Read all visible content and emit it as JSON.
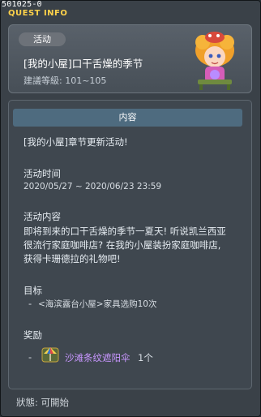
{
  "window": {
    "id_text": "501025-0",
    "title": "QUEST INFO"
  },
  "header": {
    "category": "活动",
    "quest_name": "[我的小屋]口干舌燥的季节",
    "level": "建議等級: 101~105"
  },
  "content": {
    "header": "内容",
    "intro": "[我的小屋]章节更新活动!",
    "period_label": "活动时间",
    "period_value": "2020/05/27 ~ 2020/06/23 23:59",
    "desc_label": "活动内容",
    "desc_lines": [
      "即将到来的口干舌燥的季节一夏天! 听说凯兰西亚",
      "很流行家庭咖啡店? 在我的小屋装扮家庭咖啡店,",
      "获得卡珊德拉的礼物吧!"
    ],
    "goal_label": "目标",
    "goal_dash": "-",
    "goal_item": "<海滨露台小屋>家具选购10次",
    "reward_label": "奖励",
    "reward_dash": "-",
    "reward_name": "沙滩条纹遮阳伞",
    "reward_count": "1个",
    "reward_icon": "beach-parasol-icon"
  },
  "status": "狀態: 可開始",
  "colors": {
    "title": "#ffd24a",
    "reward_name": "#c896ff",
    "content_header": "#4e6b7f"
  }
}
